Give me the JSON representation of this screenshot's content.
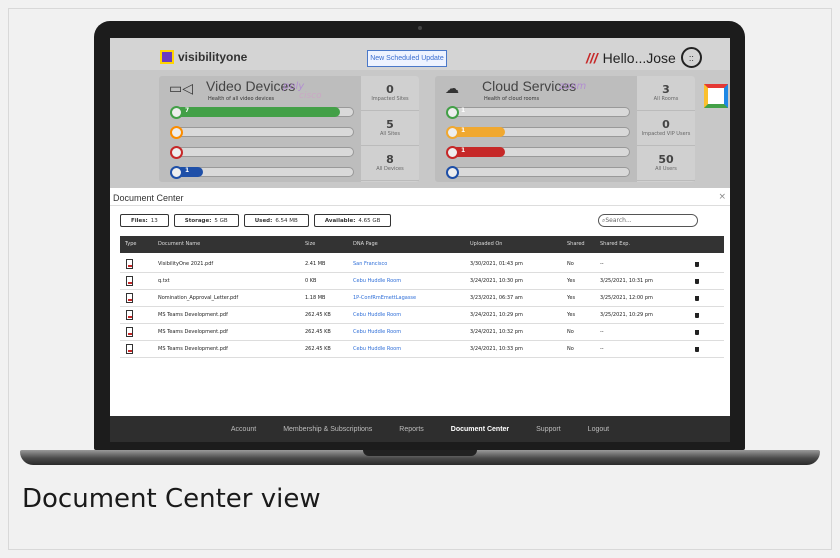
{
  "header": {
    "logo_text": "visibilityone",
    "scheduled_update": "New Scheduled Update",
    "greeting": "Hello...Jose"
  },
  "video_panel": {
    "title": "Video Devices",
    "subtitle": "Health of all video devices",
    "brands": [
      "poly",
      "cisco"
    ],
    "bars": [
      {
        "value": "7",
        "fill": 0.92,
        "color": "#43a047"
      },
      {
        "value": "",
        "fill": 0.0,
        "color": "#fb8c00"
      },
      {
        "value": "",
        "fill": 0.0,
        "color": "#c62828"
      },
      {
        "value": "1",
        "fill": 0.15,
        "color": "#1e4fa8"
      }
    ],
    "stats": [
      {
        "num": "0",
        "label": "Impacted Sites"
      },
      {
        "num": "5",
        "label": "All Sites"
      },
      {
        "num": "8",
        "label": "All Devices"
      }
    ]
  },
  "cloud_panel": {
    "title": "Cloud Services",
    "subtitle": "Health of cloud rooms",
    "brand": "zoom",
    "bars": [
      {
        "value": "1",
        "fill": 0.0,
        "color": "#43a047"
      },
      {
        "value": "1",
        "fill": 0.3,
        "color": "#f0a830"
      },
      {
        "value": "1",
        "fill": 0.3,
        "color": "#c62828"
      },
      {
        "value": "",
        "fill": 0.0,
        "color": "#1e4fa8"
      }
    ],
    "stats": [
      {
        "num": "3",
        "label": "All Rooms"
      },
      {
        "num": "0",
        "label": "Impacted VIP Users"
      },
      {
        "num": "50",
        "label": "All Users"
      }
    ]
  },
  "doc_center": {
    "title": "Document Center",
    "close": "×",
    "files_label": "Files:",
    "files_value": "13",
    "storage_label": "Storage:",
    "storage_value": "5 GB",
    "used_label": "Used:",
    "used_value": "6.54 MB",
    "available_label": "Available:",
    "available_value": "4.65 GB",
    "search_placeholder": "Search...",
    "columns": [
      "Type",
      "Document Name",
      "Size",
      "DNA Page",
      "Uploaded On",
      "Shared",
      "Shared Exp."
    ],
    "rows": [
      {
        "name": "VisibilityOne 2021.pdf",
        "size": "2.41 MB",
        "dna": "San Francisco",
        "uploaded": "3/30/2021, 01:43 pm",
        "shared": "No",
        "exp": "--"
      },
      {
        "name": "q.txt",
        "size": "0 KB",
        "dna": "Cebu Huddle Room",
        "uploaded": "3/24/2021, 10:30 pm",
        "shared": "Yes",
        "exp": "3/25/2021, 10:31 pm"
      },
      {
        "name": "Nomination_Approval_Letter.pdf",
        "size": "1.18 MB",
        "dna": "1P-ConfRmEmettLagasse",
        "uploaded": "3/23/2021, 06:37 am",
        "shared": "Yes",
        "exp": "3/25/2021, 12:00 pm"
      },
      {
        "name": "MS Teams Development.pdf",
        "size": "262.45 KB",
        "dna": "Cebu Huddle Room",
        "uploaded": "3/24/2021, 10:29 pm",
        "shared": "Yes",
        "exp": "3/25/2021, 10:29 pm"
      },
      {
        "name": "MS Teams Development.pdf",
        "size": "262.45 KB",
        "dna": "Cebu Huddle Room",
        "uploaded": "3/24/2021, 10:32 pm",
        "shared": "No",
        "exp": "--"
      },
      {
        "name": "MS Teams Development.pdf",
        "size": "262.45 KB",
        "dna": "Cebu Huddle Room",
        "uploaded": "3/24/2021, 10:33 pm",
        "shared": "No",
        "exp": "--"
      }
    ]
  },
  "footer": {
    "items": [
      "Account",
      "Membership & Subscriptions",
      "Reports",
      "Document Center",
      "Support",
      "Logout"
    ],
    "active_index": 3
  },
  "caption": "Document Center view"
}
